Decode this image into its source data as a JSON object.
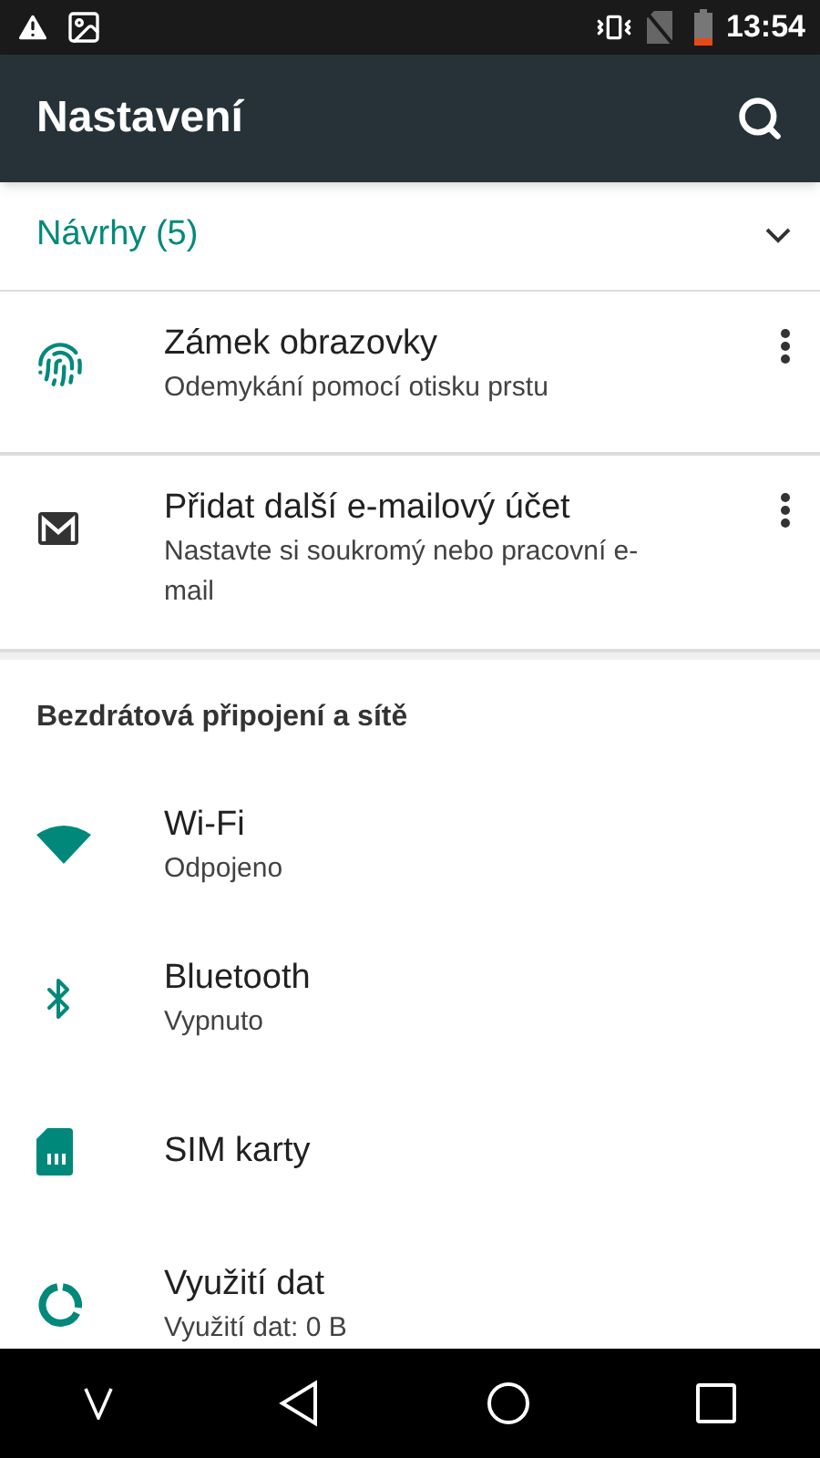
{
  "status_bar": {
    "time": "13:54"
  },
  "toolbar": {
    "title": "Nastavení"
  },
  "suggestions": {
    "title": "Návrhy (5)",
    "expanded": false,
    "items": [
      {
        "kind": "fingerprint",
        "title": "Zámek obrazovky",
        "subtitle": "Odemykání pomocí otisku prstu"
      },
      {
        "kind": "mail",
        "title": "Přidat další e-mailový účet",
        "subtitle": "Nastavte si soukromý nebo pracovní e-mail"
      }
    ]
  },
  "section": {
    "title": "Bezdrátová připojení a sítě",
    "items": [
      {
        "kind": "wifi",
        "title": "Wi-Fi",
        "subtitle": "Odpojeno"
      },
      {
        "kind": "bluetooth",
        "title": "Bluetooth",
        "subtitle": "Vypnuto"
      },
      {
        "kind": "sim",
        "title": "SIM karty"
      },
      {
        "kind": "data",
        "title": "Využití dat",
        "subtitle": "Využití dat: 0 B"
      }
    ]
  }
}
